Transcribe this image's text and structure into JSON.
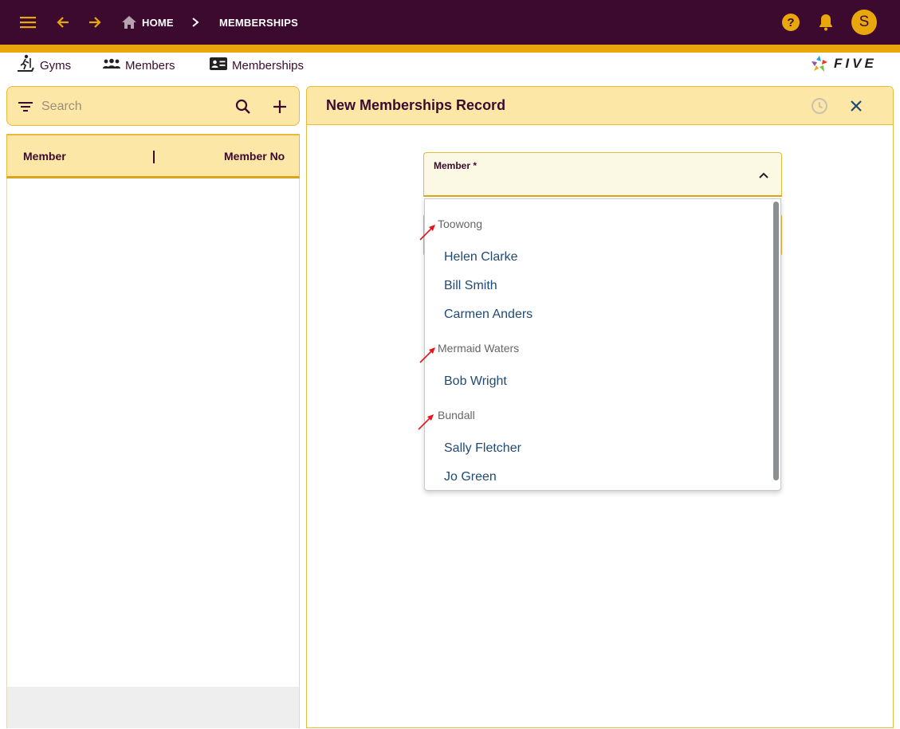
{
  "topbar": {
    "breadcrumb_home": "HOME",
    "breadcrumb_current": "MEMBERSHIPS",
    "avatar_initial": "S",
    "icons": [
      "menu-icon",
      "back-arrow-icon",
      "forward-arrow-icon",
      "home-icon",
      "chevron-right-icon",
      "help-icon",
      "bell-icon"
    ]
  },
  "nav": {
    "items": [
      {
        "label": "Gyms",
        "icon": "treadmill-icon"
      },
      {
        "label": "Members",
        "icon": "people-icon"
      },
      {
        "label": "Memberships",
        "icon": "id-card-icon"
      }
    ],
    "logo_text": "FIVE"
  },
  "left_panel": {
    "search_placeholder": "Search",
    "columns": [
      "Member",
      "Member No"
    ]
  },
  "form": {
    "title": "New Memberships Record",
    "member_label": "Member *",
    "dropdown": {
      "groups": [
        {
          "name": "Toowong",
          "options": [
            "Helen Clarke",
            "Bill Smith",
            "Carmen Anders"
          ]
        },
        {
          "name": "Mermaid Waters",
          "options": [
            "Bob Wright"
          ]
        },
        {
          "name": "Bundall",
          "options": [
            "Sally Fletcher",
            "Jo Green"
          ]
        }
      ]
    }
  },
  "colors": {
    "topbar": "#3b0a2e",
    "accent": "#e8a80c",
    "panel_header": "#fde7a7",
    "option_text": "#1f4a73",
    "annotation_arrow": "#e8141b"
  }
}
